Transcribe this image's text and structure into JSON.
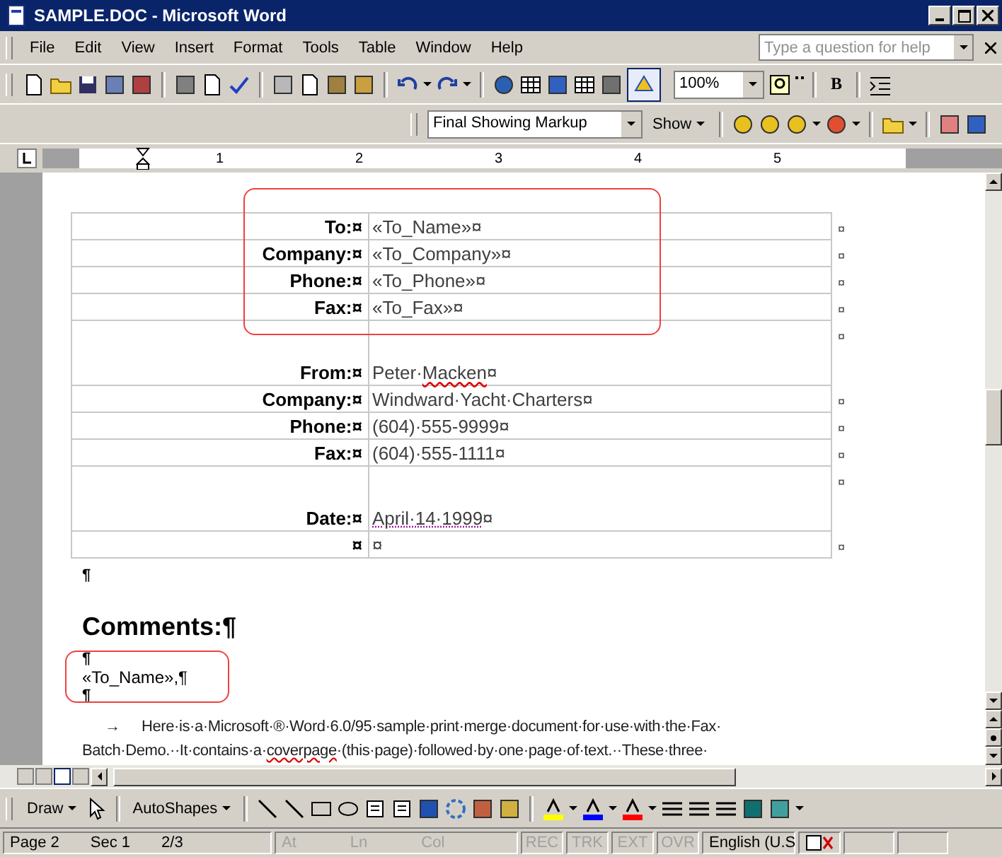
{
  "window": {
    "title": "SAMPLE.DOC - Microsoft Word"
  },
  "menu": [
    "File",
    "Edit",
    "View",
    "Insert",
    "Format",
    "Tools",
    "Table",
    "Window",
    "Help"
  ],
  "help_box": {
    "placeholder": "Type a question for help"
  },
  "standard_toolbar": {
    "drawing_on": true,
    "zoom": "100%",
    "bold": "B"
  },
  "reviewing_toolbar": {
    "display": "Final Showing Markup",
    "show": "Show"
  },
  "ruler": [
    "1",
    "2",
    "3",
    "4",
    "5"
  ],
  "drawing_toolbar": {
    "draw": "Draw",
    "autoshapes": "AutoShapes"
  },
  "table": {
    "rows": [
      {
        "kind": "normal",
        "label": "To:¤",
        "value": [
          {
            "text": "«To_Name»¤"
          }
        ],
        "end": "¤"
      },
      {
        "kind": "normal",
        "label": "Company:¤",
        "value": [
          {
            "text": "«To_Company»¤"
          }
        ],
        "end": "¤"
      },
      {
        "kind": "normal",
        "label": "Phone:¤",
        "value": [
          {
            "text": "«To_Phone»¤"
          }
        ],
        "end": "¤"
      },
      {
        "kind": "normal",
        "label": "Fax:¤",
        "value": [
          {
            "text": "«To_Fax»¤"
          }
        ],
        "end": "¤"
      },
      {
        "kind": "tall",
        "label": "From:¤",
        "value": [
          {
            "text": "Peter·"
          },
          {
            "text": "Macken",
            "misspelled": true
          },
          {
            "text": "¤"
          }
        ],
        "end": "¤"
      },
      {
        "kind": "normal",
        "label": "Company:¤",
        "value": [
          {
            "text": "Windward·Yacht·Charters¤"
          }
        ],
        "end": "¤"
      },
      {
        "kind": "normal",
        "label": "Phone:¤",
        "value": [
          {
            "text": "(604)·555-9999¤"
          }
        ],
        "end": "¤"
      },
      {
        "kind": "normal",
        "label": "Fax:¤",
        "value": [
          {
            "text": "(604)·555-1111¤"
          }
        ],
        "end": "¤"
      },
      {
        "kind": "tall",
        "label": "Date:¤",
        "value": [
          {
            "text": "April·14·1999",
            "smart_tag": true
          },
          {
            "text": "¤"
          }
        ],
        "end": "¤"
      },
      {
        "kind": "normal",
        "label": "¤",
        "value": [
          {
            "text": "¤"
          }
        ],
        "end": "¤"
      }
    ]
  },
  "body": [
    {
      "kind": "mark",
      "parts": [
        {
          "text": "¶"
        }
      ]
    },
    {
      "kind": "heading",
      "parts": [
        {
          "text": "Comments:¶"
        }
      ]
    },
    {
      "kind": "mark",
      "parts": [
        {
          "text": "¶"
        }
      ]
    },
    {
      "kind": "merge",
      "parts": [
        {
          "text": "«To_Name»,¶"
        }
      ]
    },
    {
      "kind": "mark",
      "parts": [
        {
          "text": "¶"
        }
      ]
    },
    {
      "kind": "body",
      "tab": "→",
      "parts": [
        {
          "text": "Here·is·a·Microsoft·®·Word·6.0/95·sample·print·merge·document·for·use·with·the·Fax·"
        }
      ]
    },
    {
      "kind": "body",
      "parts": [
        {
          "text": "Batch·Demo.··It·contains·a·"
        },
        {
          "text": "coverpage",
          "misspelled": true
        },
        {
          "text": "·(this·page)·followed·by·one·page·of·text.··These·three·"
        }
      ]
    }
  ],
  "status_bar": {
    "page": "Page 2",
    "section": "Sec 1",
    "pages": "2/3",
    "at": "At",
    "ln": "Ln",
    "col": "Col",
    "modes": [
      {
        "label": "REC",
        "on": false
      },
      {
        "label": "TRK",
        "on": false
      },
      {
        "label": "EXT",
        "on": false
      },
      {
        "label": "OVR",
        "on": false
      }
    ],
    "language": "English (U.S"
  }
}
